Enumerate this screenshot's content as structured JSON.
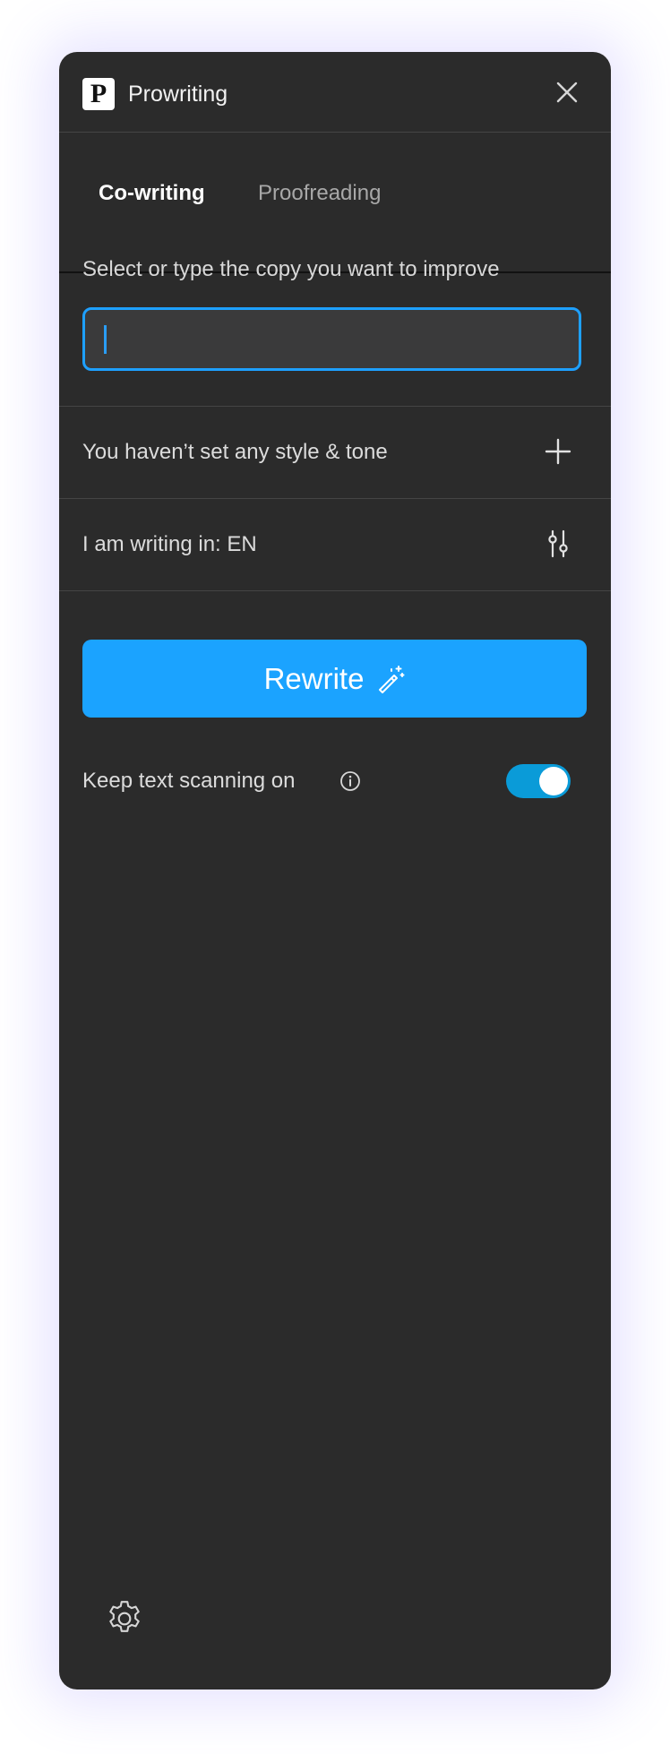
{
  "app": {
    "logo_letter": "P",
    "title": "Prowriting",
    "close_icon": "close-icon"
  },
  "tabs": [
    {
      "label": "Co-writing",
      "active": true
    },
    {
      "label": "Proofreading",
      "active": false
    }
  ],
  "copy": {
    "prompt": "Select or type the copy you want to improve",
    "value": ""
  },
  "style_tone": {
    "label": "You haven’t set any style & tone",
    "icon": "plus-icon"
  },
  "language": {
    "label": "I am writing in: EN",
    "icon": "sliders-icon"
  },
  "rewrite": {
    "label": "Rewrite",
    "icon": "magic-wand-icon"
  },
  "scanning": {
    "label": "Keep text scanning on",
    "info_icon": "info-icon",
    "enabled": true
  },
  "footer": {
    "settings_icon": "gear-icon"
  },
  "colors": {
    "panel_bg": "#2b2b2b",
    "accent": "#1ba3ff",
    "input_border": "#1ea0ff",
    "toggle_on": "#0a9bd8",
    "backdrop_glow": "#7c6cff"
  }
}
